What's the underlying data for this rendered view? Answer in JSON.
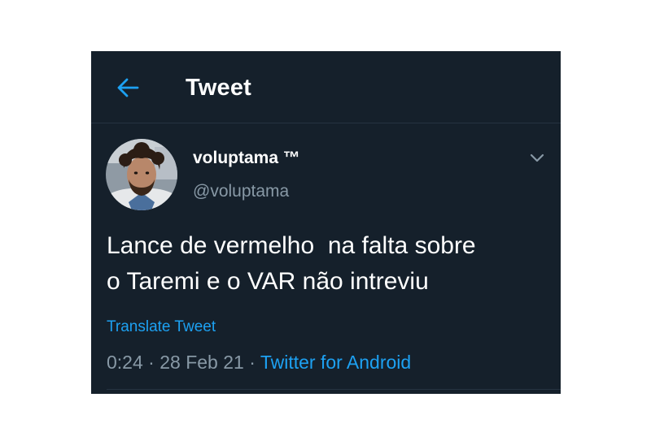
{
  "header": {
    "title": "Tweet",
    "back_icon": "arrow-left-icon"
  },
  "author": {
    "display_name": "voluptama ™",
    "handle": "@voluptama",
    "avatar_icon": "user-avatar"
  },
  "tweet": {
    "text": "Lance de vermelho  na falta sobre\no Taremi e o VAR não intreviu",
    "translate_label": "Translate Tweet",
    "time": "0:24",
    "separator": " · ",
    "date": "28 Feb 21",
    "source": "Twitter for Android"
  },
  "colors": {
    "background": "#15202b",
    "accent": "#1da1f2",
    "secondary_text": "#8899a6",
    "divider": "#253341"
  }
}
